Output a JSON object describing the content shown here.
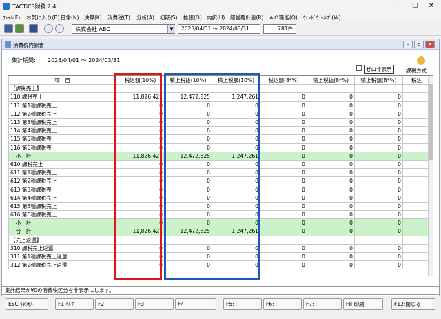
{
  "window": {
    "title": "TACTiCS財務２４",
    "min": "–",
    "max": "☐",
    "close": "✕"
  },
  "menu": [
    "ﾌｧｲﾙ(F)",
    "お気に入り(B)",
    "日常(N)",
    "決算(K)",
    "消費税(T)",
    "分析(A)",
    "初期(S)",
    "拡張(O)",
    "内訳(U)",
    "経営羅針盤(R)",
    "ＡＯ職能(Q)",
    "ｳｨﾝﾄﾞｳ･ﾍﾙﾌﾟ(W)"
  ],
  "toolbar": {
    "company": "株式会社 ABC",
    "period": "2023/04/01 ～ 2024/03/31",
    "count": "781件"
  },
  "inner": {
    "title": "消費税内訳書",
    "period_label": "集計期間:",
    "period_value": "2023/04/01 ～ 2024/03/31",
    "zero_hide": "ゼロ非表示",
    "tax_method": "課税方式"
  },
  "table": {
    "headers": [
      "項　目",
      "税込額(10%)",
      "積上税抜(10%)",
      "積上税額(10%)",
      "税込額(8*%)",
      "積上税抜(8*%)",
      "積上税額(8*%)",
      "税込"
    ],
    "rows": [
      {
        "label": "【課税売上】",
        "vals": [
          "",
          "",
          "",
          "",
          "",
          "",
          ""
        ],
        "sub": false
      },
      {
        "label": "110 課税売上",
        "vals": [
          "11,826,421",
          "12,472,825",
          "1,247,261",
          "0",
          "0",
          "0",
          ""
        ],
        "sub": false
      },
      {
        "label": "111 第1種課税売上",
        "vals": [
          "0",
          "0",
          "0",
          "0",
          "0",
          "0",
          ""
        ],
        "sub": false
      },
      {
        "label": "112 第2種課税売上",
        "vals": [
          "0",
          "0",
          "0",
          "0",
          "0",
          "0",
          ""
        ],
        "sub": false
      },
      {
        "label": "113 第3種課税売上",
        "vals": [
          "0",
          "0",
          "0",
          "0",
          "0",
          "0",
          ""
        ],
        "sub": false
      },
      {
        "label": "114 第4種課税売上",
        "vals": [
          "0",
          "0",
          "0",
          "0",
          "0",
          "0",
          ""
        ],
        "sub": false
      },
      {
        "label": "115 第5種課税売上",
        "vals": [
          "0",
          "0",
          "0",
          "0",
          "0",
          "0",
          ""
        ],
        "sub": false
      },
      {
        "label": "116 第6種課税売上",
        "vals": [
          "0",
          "0",
          "0",
          "0",
          "0",
          "0",
          ""
        ],
        "sub": false
      },
      {
        "label": "　小　計",
        "vals": [
          "11,826,421",
          "12,472,825",
          "1,247,261",
          "0",
          "0",
          "0",
          ""
        ],
        "sub": true
      },
      {
        "label": "610 課税売上",
        "vals": [
          "0",
          "0",
          "0",
          "0",
          "0",
          "0",
          ""
        ],
        "sub": false
      },
      {
        "label": "611 第1種課税売上",
        "vals": [
          "0",
          "0",
          "0",
          "0",
          "0",
          "0",
          ""
        ],
        "sub": false
      },
      {
        "label": "612 第2種課税売上",
        "vals": [
          "0",
          "0",
          "0",
          "0",
          "0",
          "0",
          ""
        ],
        "sub": false
      },
      {
        "label": "613 第3種課税売上",
        "vals": [
          "0",
          "0",
          "0",
          "0",
          "0",
          "0",
          ""
        ],
        "sub": false
      },
      {
        "label": "614 第4種課税売上",
        "vals": [
          "0",
          "0",
          "0",
          "0",
          "0",
          "0",
          ""
        ],
        "sub": false
      },
      {
        "label": "615 第5種課税売上",
        "vals": [
          "0",
          "0",
          "0",
          "0",
          "0",
          "0",
          ""
        ],
        "sub": false
      },
      {
        "label": "616 第6種課税売上",
        "vals": [
          "0",
          "0",
          "0",
          "0",
          "0",
          "0",
          ""
        ],
        "sub": false
      },
      {
        "label": "　小　計",
        "vals": [
          "0",
          "0",
          "0",
          "0",
          "0",
          "0",
          ""
        ],
        "sub": true
      },
      {
        "label": "　合　計",
        "vals": [
          "11,826,421",
          "12,472,825",
          "1,247,261",
          "0",
          "0",
          "0",
          ""
        ],
        "sub": true
      },
      {
        "label": "【売上返還】",
        "vals": [
          "",
          "",
          "",
          "",
          "",
          "",
          ""
        ],
        "sub": false
      },
      {
        "label": "310 課税売上返還",
        "vals": [
          "0",
          "0",
          "0",
          "0",
          "0",
          "0",
          ""
        ],
        "sub": false
      },
      {
        "label": "311 第1種課税売上返還",
        "vals": [
          "0",
          "0",
          "0",
          "0",
          "0",
          "0",
          ""
        ],
        "sub": false
      },
      {
        "label": "312 第2種課税売上返還",
        "vals": [
          "0",
          "0",
          "0",
          "0",
          "0",
          "0",
          ""
        ],
        "sub": false
      }
    ]
  },
  "status": "集計結果が¥0の消費税区分を非表示にします。",
  "fkeys": [
    "ESC ｷｬﾝｾﾙ",
    "F1:ﾍﾙﾌﾟ",
    "F2:",
    "F3:",
    "F4:",
    "F5:",
    "F6:",
    "F7:",
    "F8:印刷",
    "F12:閉じる"
  ],
  "colors": {
    "highlight_red": "#e0141a",
    "highlight_blue": "#1e58b8",
    "subtotal_row": "#ccf2cc"
  }
}
